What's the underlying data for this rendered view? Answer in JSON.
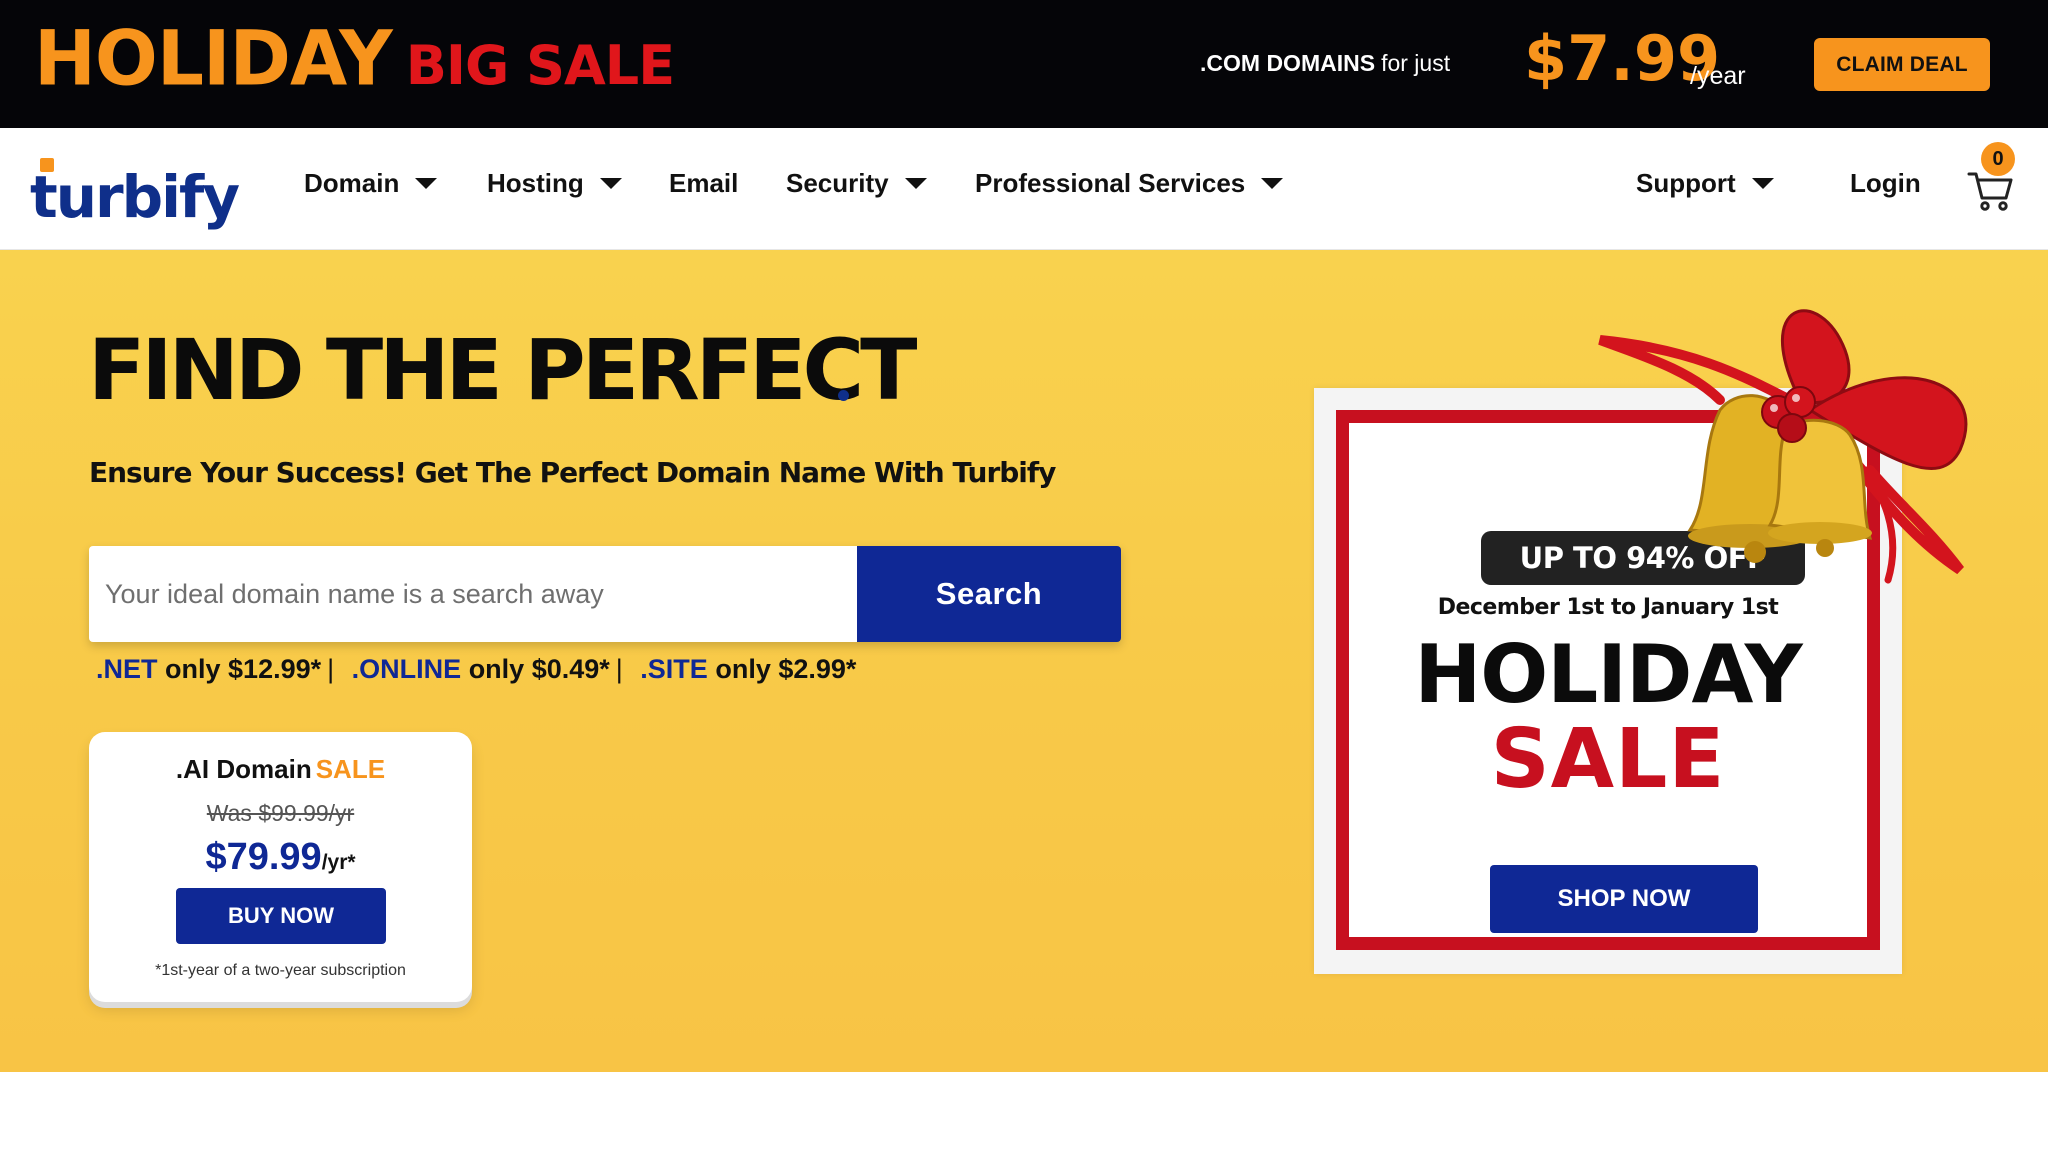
{
  "promo": {
    "headline_main": "HOLIDAY",
    "headline_secondary": "BIG SALE",
    "domains_label": ".COM DOMAINS",
    "domains_suffix": "for just",
    "price": "$7.99",
    "price_unit": "/year",
    "cta": "CLAIM DEAL"
  },
  "nav": {
    "logo": "turbify",
    "items": [
      {
        "label": "Domain",
        "dropdown": true
      },
      {
        "label": "Hosting",
        "dropdown": true
      },
      {
        "label": "Email",
        "dropdown": false
      },
      {
        "label": "Security",
        "dropdown": true
      },
      {
        "label": "Professional Services",
        "dropdown": true
      }
    ],
    "support": "Support",
    "login": "Login",
    "cart_count": "0"
  },
  "hero": {
    "title": "FIND THE PERFECT",
    "subtitle": "Ensure Your Success! Get The Perfect Domain Name With Turbify",
    "search": {
      "placeholder": "Your ideal domain name is a search away",
      "value": "",
      "button": "Search"
    },
    "tld_offers": [
      {
        "tld": ".NET",
        "price": "only $12.99*"
      },
      {
        "tld": ".ONLINE",
        "price": "only $0.49*"
      },
      {
        "tld": ".SITE",
        "price": "only $2.99*"
      }
    ],
    "tld_separator": "|"
  },
  "ai_card": {
    "title": ".AI Domain",
    "title_highlight": "SALE",
    "was": "Was $99.99/yr",
    "price": "$79.99",
    "price_unit": "/yr*",
    "button": "BUY NOW",
    "note": "*1st-year of a two-year subscription"
  },
  "holiday_card": {
    "badge": "UP TO 94% OFF",
    "dates": "December 1st to January 1st",
    "word1": "HOLIDAY",
    "word2": "SALE",
    "button": "SHOP NOW"
  },
  "colors": {
    "orange": "#f7941d",
    "red": "#e0161b",
    "navy": "#0f2895",
    "hero_yellow": "#f9d24e",
    "banner_black": "#050508"
  },
  "icons": [
    "caret-down-icon",
    "cart-icon",
    "bells-ribbon-decoration"
  ]
}
